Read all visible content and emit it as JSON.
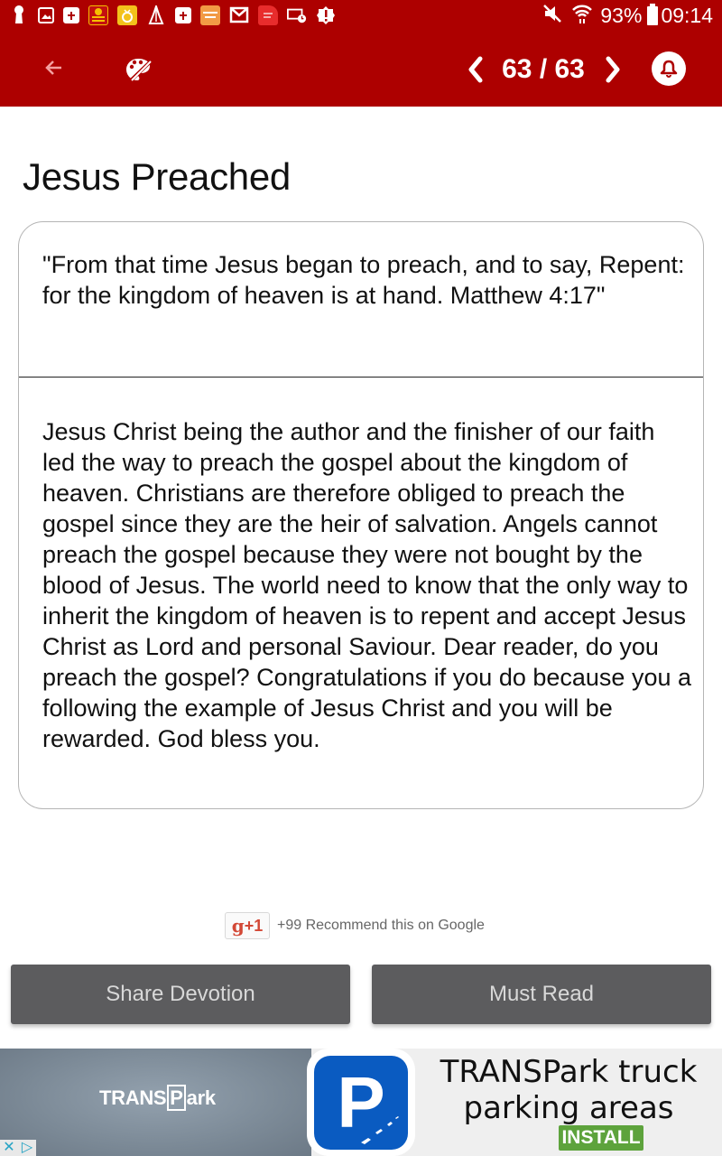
{
  "status_bar": {
    "notification_icons": [
      "keyhole-icon",
      "image-icon",
      "bible-icon",
      "jesus-quotes-app-icon",
      "ring-app-icon",
      "praying-hands-icon",
      "bible-icon",
      "healing-scriptures-app-icon",
      "gmail-icon",
      "app-icon",
      "screen-timer-icon",
      "alert-icon"
    ],
    "battery": "93%",
    "time": "09:14"
  },
  "app_bar": {
    "page_counter": "63 / 63",
    "current_page": 63,
    "total_pages": 63
  },
  "devotion": {
    "title": "Jesus Preached",
    "verse": "\"From that time Jesus began to preach, and to say, Repent: for the kingdom of heaven is at hand. Matthew 4:17\"",
    "body": "Jesus Christ being the author and the finisher of our faith led the way to preach the gospel about the kingdom of heaven. Christians are therefore obliged to preach the gospel since they are the heir of salvation. Angels cannot preach the gospel because they were not bought by the blood of Jesus. The world need to know that the only way to inherit the kingdom of heaven is to repent and accept Jesus Christ as Lord and personal Saviour. Dear reader, do you preach the gospel? Congratulations if you do because you a following the example of Jesus Christ and you will be rewarded. God bless you."
  },
  "google_plus": {
    "button_g": "g",
    "button_plus": "+1",
    "text": "+99 Recommend this on Google"
  },
  "actions": {
    "share_label": "Share Devotion",
    "must_read_label": "Must Read"
  },
  "ad": {
    "brand_prefix": "TRANS",
    "brand_p": "P",
    "brand_suffix": "ark",
    "icon_letter": "P",
    "headline": "TRANSPark truck parking areas",
    "install_label": "INSTALL",
    "close_glyph": "✕",
    "adchoices_glyph": "▷"
  },
  "colors": {
    "primary": "#ad0000",
    "button_gray": "#5c5c5e",
    "install_green": "#5da33c",
    "ad_icon_blue": "#0a5bc1"
  }
}
